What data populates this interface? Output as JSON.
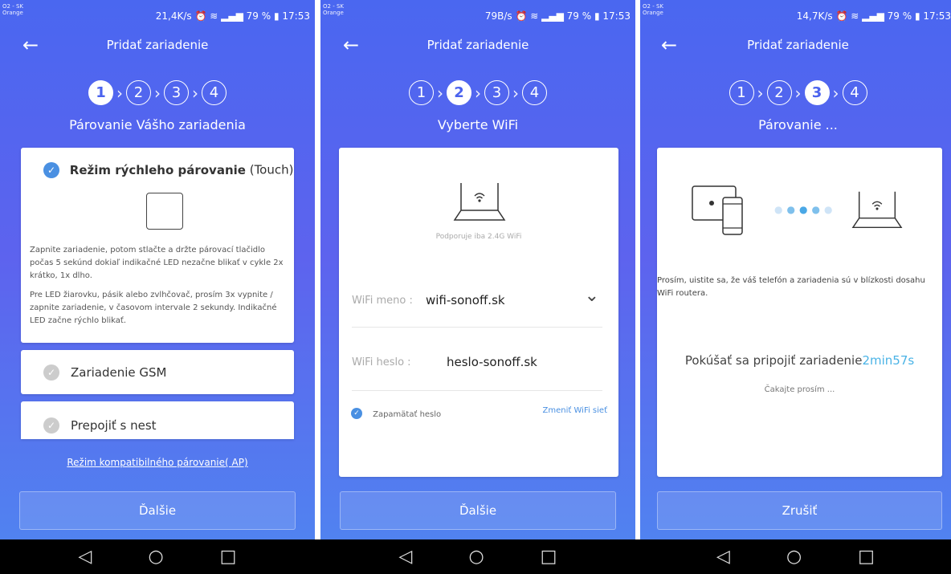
{
  "status_bar": {
    "carrier_1": "O2 - SK",
    "carrier_2": "Orange",
    "battery": "79 %",
    "time": "17:53",
    "speeds": [
      "21,4K/s",
      "79B/s",
      "14,7K/s"
    ]
  },
  "common": {
    "title": "Pridať zariadenie",
    "back_icon": "arrow-left-icon",
    "steps": [
      "1",
      "2",
      "3",
      "4"
    ],
    "nav_icons": [
      "back-triangle-icon",
      "home-circle-icon",
      "recents-square-icon"
    ]
  },
  "screen1": {
    "subtitle": "Párovanie Vášho zariadenia",
    "option1_bold": "Režim rýchleho párovanie",
    "option1_suffix": " (Touch)",
    "desc1": "Zapnite zariadenie, potom stlačte a držte párovací tlačidlo počas 5 sekúnd dokiaľ indikačné LED nezačne blikať v cykle 2x krátko, 1x dlho.",
    "desc2": "Pre LED žiarovku, pásik alebo zvlhčovač, prosím 3x vypnite / zapnite zariadenie, v časovom intervale 2 sekundy. Indikačné LED začne rýchlo blikať.",
    "option2": "Zariadenie GSM",
    "option3": "Prepojiť s nest",
    "compat_link": "Režim kompatibilného párovanie( AP)",
    "next_button": "Ďalšie"
  },
  "screen2": {
    "subtitle": "Vyberte WiFi",
    "support_note": "Podporuje iba 2.4G WiFi",
    "wifi_name_label": "WiFi meno :",
    "wifi_name_value": "wifi-sonoff.sk",
    "wifi_pass_label": "WiFi heslo :",
    "wifi_pass_value": "heslo-sonoff.sk",
    "remember_label": "Zapamätať heslo",
    "change_link": "Zmeniť WiFi sieť",
    "next_button": "Ďalšie"
  },
  "screen3": {
    "subtitle": "Párovanie ...",
    "note": "Prosím, uistite sa, že váš telefón a zariadenia sú v blízkosti dosahu WiFi routera.",
    "connecting": "Pokúšať sa pripojiť zariadenie",
    "countdown": "2min57s",
    "wait": "Čakajte prosím ...",
    "cancel_button": "Zrušiť",
    "accent_color": "#4ab3e6"
  }
}
